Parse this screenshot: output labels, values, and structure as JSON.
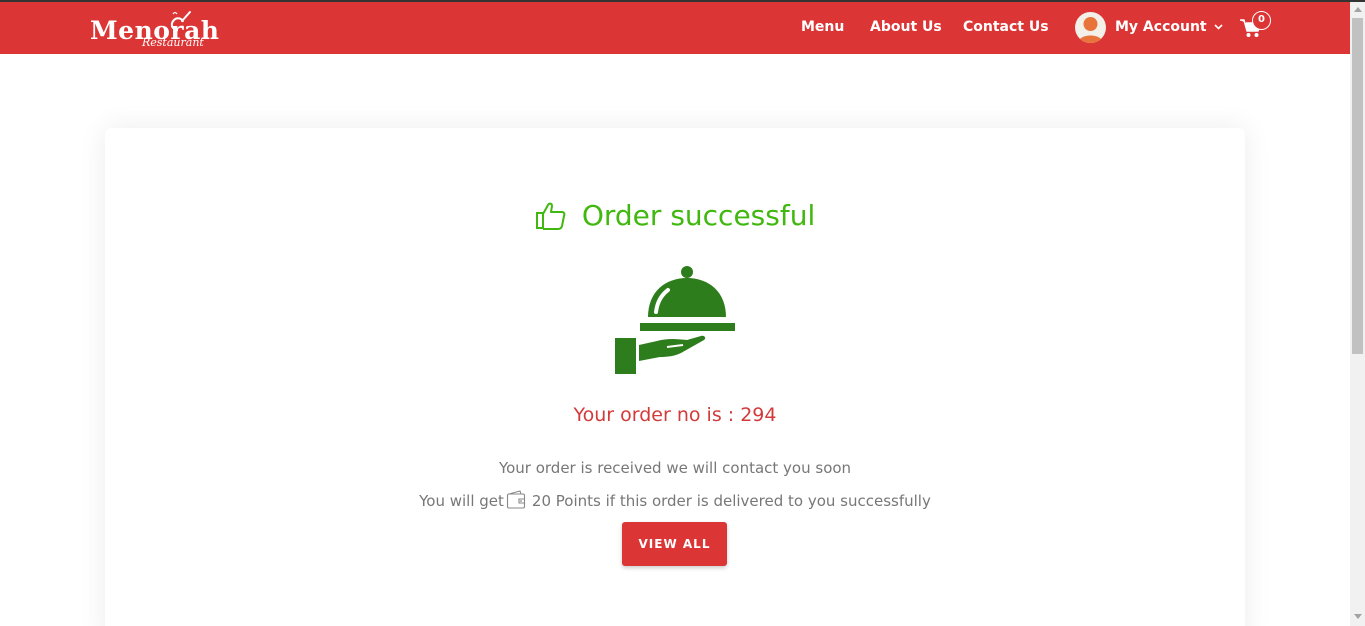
{
  "brand": {
    "logo_main": "Menorah",
    "logo_sub": "Restaurant",
    "nav_color": "#dc3535"
  },
  "nav": {
    "links": [
      "Menu",
      "About Us",
      "Contact Us"
    ],
    "account_label": "My Account",
    "cart_count": "0",
    "avatar_icon": "user-avatar-icon",
    "cart_icon": "shopping-cart-icon"
  },
  "success": {
    "title": "Order successful",
    "title_icon": "thumbs-up-icon",
    "title_color": "#41b80f",
    "illustration_icon": "serving-cloche-hand-icon",
    "illustration_color": "#2e7d1c",
    "order_number_text": "Your order no is : 294",
    "received_message": "Your order is received we will contact you soon",
    "points_prefix": "You will get",
    "points_suffix": "20 Points if this order is delivered to you successfully",
    "wallet_icon": "wallet-icon",
    "view_all_label": "VIEW ALL"
  }
}
